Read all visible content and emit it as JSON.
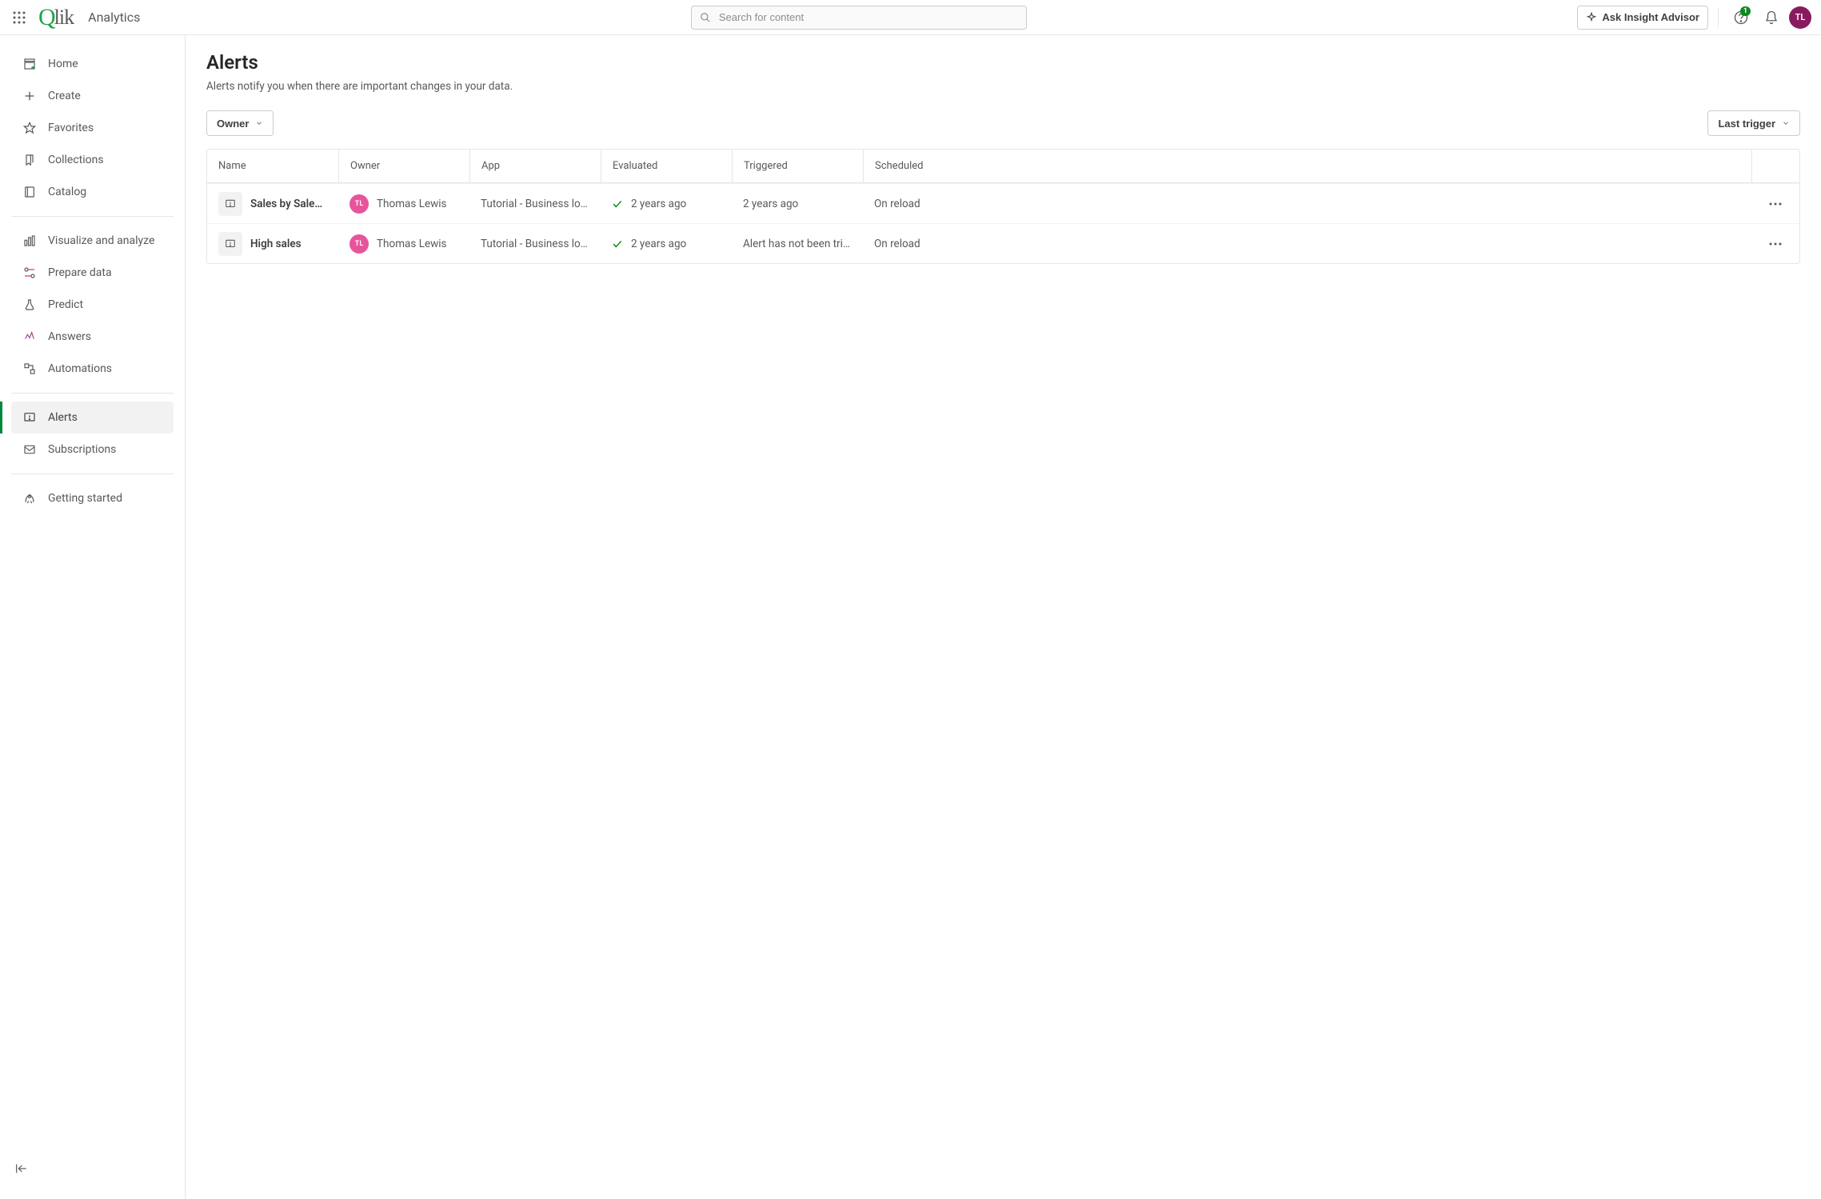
{
  "header": {
    "app_name": "Analytics",
    "search_placeholder": "Search for content",
    "insight_label": "Ask Insight Advisor",
    "badge_count": "1",
    "avatar_initials": "TL"
  },
  "sidebar": {
    "items": [
      {
        "label": "Home",
        "active": false
      },
      {
        "label": "Create",
        "active": false
      },
      {
        "label": "Favorites",
        "active": false
      },
      {
        "label": "Collections",
        "active": false
      },
      {
        "label": "Catalog",
        "active": false
      }
    ],
    "group2": [
      {
        "label": "Visualize and analyze"
      },
      {
        "label": "Prepare data"
      },
      {
        "label": "Predict"
      },
      {
        "label": "Answers"
      },
      {
        "label": "Automations"
      }
    ],
    "group3": [
      {
        "label": "Alerts",
        "active": true
      },
      {
        "label": "Subscriptions"
      }
    ],
    "group4": [
      {
        "label": "Getting started"
      }
    ]
  },
  "main": {
    "title": "Alerts",
    "description": "Alerts notify you when there are important changes in your data.",
    "filter_owner_label": "Owner",
    "sort_label": "Last trigger",
    "columns": {
      "name": "Name",
      "owner": "Owner",
      "app": "App",
      "evaluated": "Evaluated",
      "triggered": "Triggered",
      "scheduled": "Scheduled"
    },
    "rows": [
      {
        "name": "Sales by SalesOff…",
        "owner": "Thomas Lewis",
        "owner_initials": "TL",
        "app": "Tutorial - Business logic",
        "evaluated": "2 years ago",
        "triggered": "2 years ago",
        "scheduled": "On reload"
      },
      {
        "name": "High sales",
        "owner": "Thomas Lewis",
        "owner_initials": "TL",
        "app": "Tutorial - Business logic",
        "evaluated": "2 years ago",
        "triggered": "Alert has not been triggered",
        "scheduled": "On reload"
      }
    ]
  }
}
